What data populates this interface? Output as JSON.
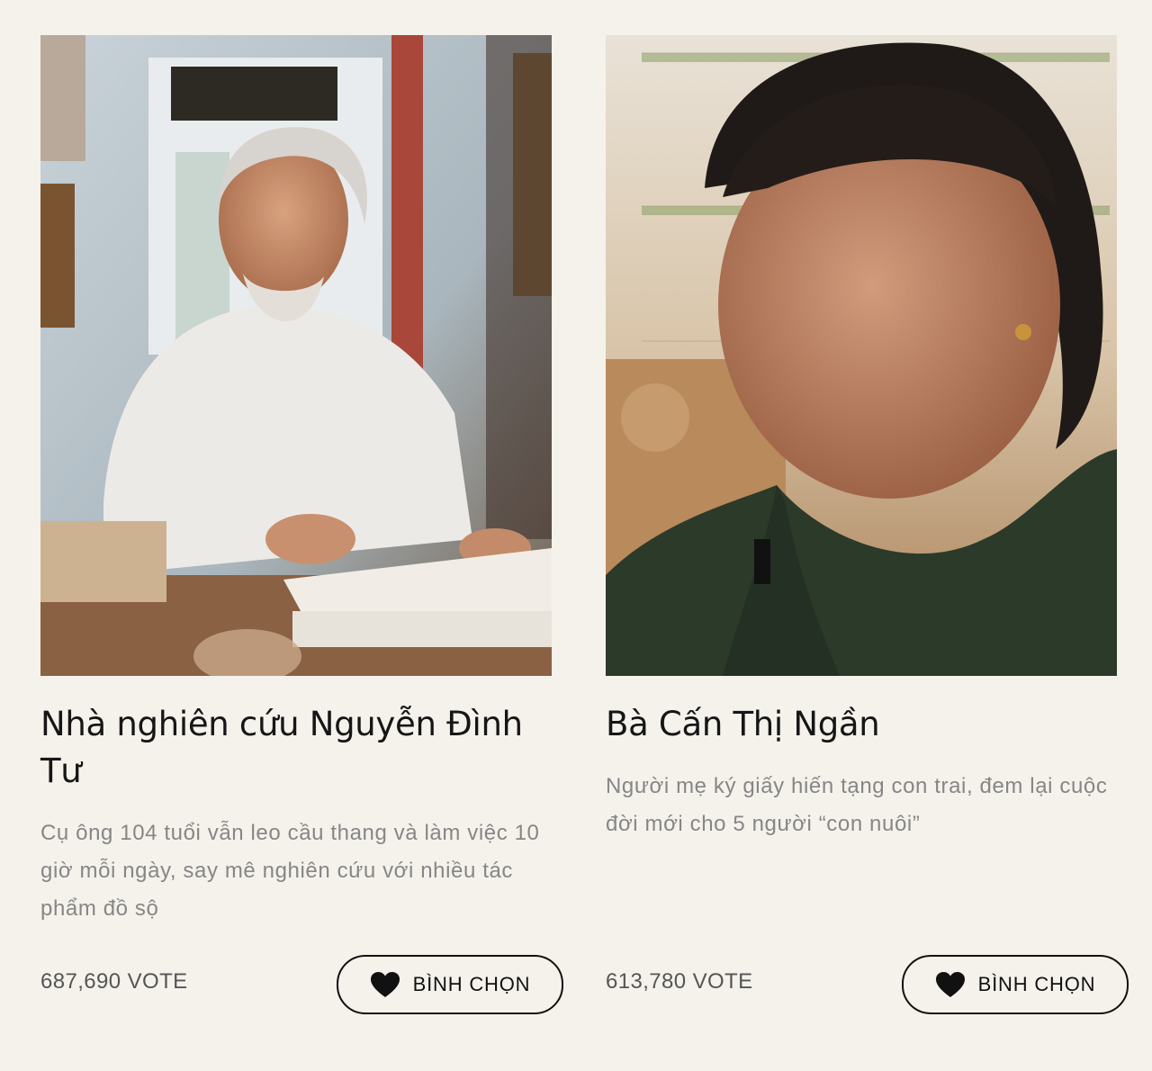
{
  "cards": [
    {
      "title": "Nhà nghiên cứu Nguyễn Đình Tư",
      "description": "Cụ ông 104 tuổi vẫn leo cầu thang và làm việc 10 giờ mỗi ngày, say mê nghiên cứu với nhiều tác phẩm đồ sộ",
      "votes": "687,690 VOTE",
      "button_label": "BÌNH CHỌN",
      "button_icon": "heart-icon"
    },
    {
      "title": "Bà Cấn Thị Ngần",
      "description": "Người mẹ ký giấy hiến tạng con trai, đem lại cuộc đời mới cho 5 người “con nuôi”",
      "votes": "613,780 VOTE",
      "button_label": "BÌNH CHỌN",
      "button_icon": "heart-icon"
    }
  ],
  "colors": {
    "background": "#f5f2ec",
    "title": "#161616",
    "description": "#868686",
    "votes": "#555555",
    "button_border": "#111111"
  }
}
